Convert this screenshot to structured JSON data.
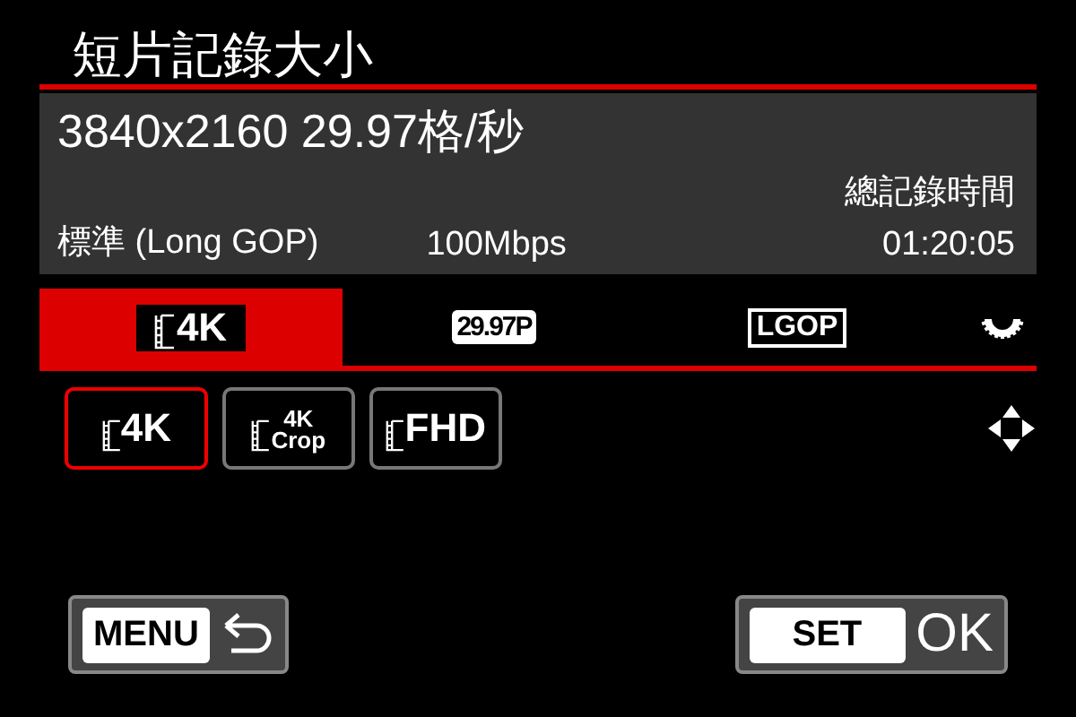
{
  "title": "短片記錄大小",
  "info": {
    "resolution": "3840x2160 29.97格/秒",
    "quality": "標準 (Long GOP)",
    "bitrate": "100Mbps",
    "total_time_label": "總記錄時間",
    "total_time": "01:20:05"
  },
  "tabs": [
    {
      "kind": "film",
      "label": "4K",
      "selected": true
    },
    {
      "kind": "badge",
      "label": "29.97P",
      "selected": false
    },
    {
      "kind": "outline",
      "label": "LGOP",
      "selected": false
    }
  ],
  "options": [
    {
      "label": "4K",
      "selected": true
    },
    {
      "label": "4K",
      "sub": "Crop",
      "selected": false
    },
    {
      "label": "FHD",
      "selected": false
    }
  ],
  "buttons": [
    {
      "kind": "menu",
      "label": "MENU"
    },
    {
      "kind": "set",
      "label": "SET",
      "suffix": "OK"
    }
  ]
}
